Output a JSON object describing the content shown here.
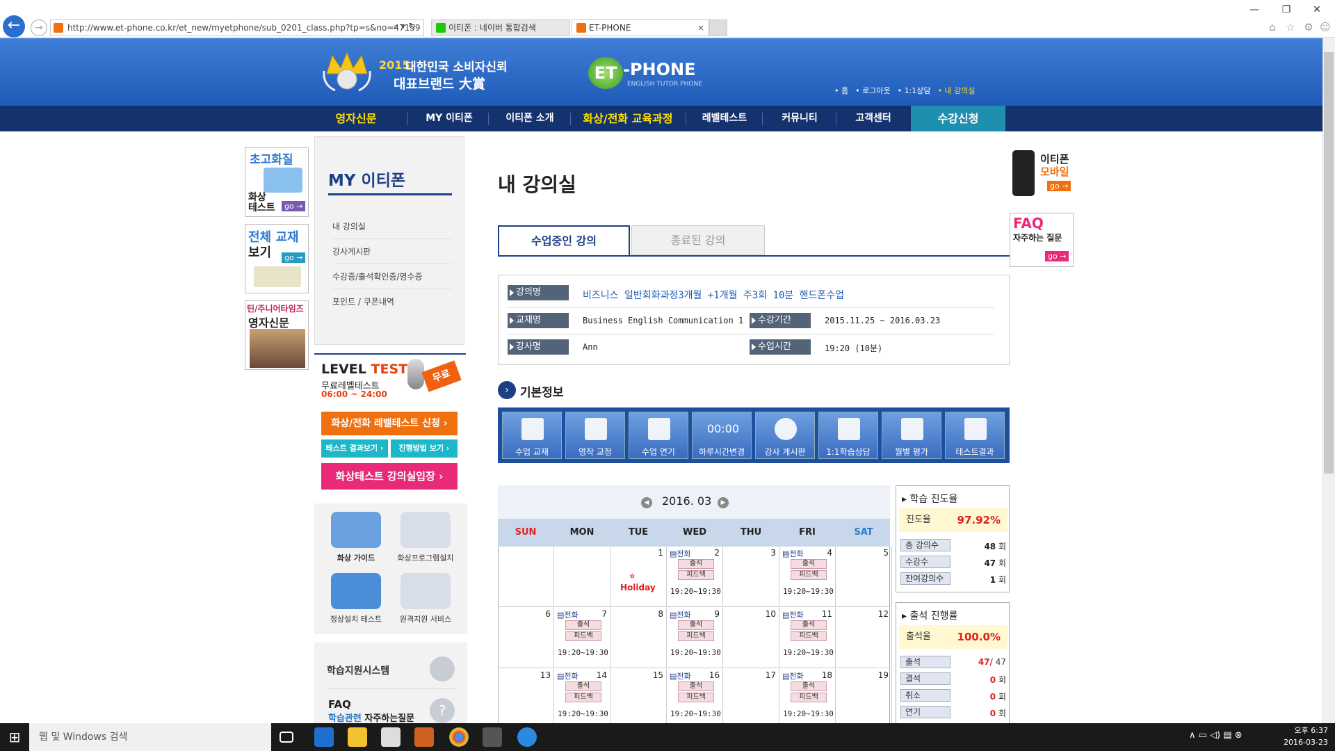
{
  "browser": {
    "url": "http://www.et-phone.co.kr/et_new/myetphone/sub_0201_class.php?tp=s&no=47159",
    "tab1": "이티폰 : 네이버 통합검색",
    "tab2": "ET-PHONE"
  },
  "header": {
    "award_year": "2015",
    "award_line1": "대한민국 소비자신뢰",
    "award_line2": "대표브랜드 大賞",
    "logo_et": "ET",
    "logo_phone": "-PHONE",
    "logo_sub": "ENGLISH TUTOR PHONE",
    "toplinks": [
      "• 홈",
      "• 로그아웃",
      "• 1:1상담",
      "• 내 강의실"
    ]
  },
  "nav": [
    "영자신문",
    "MY 이티폰",
    "이티폰 소개",
    "화상/전화 교육과정",
    "레벨테스트",
    "커뮤니티",
    "고객센터",
    "수강신청"
  ],
  "left_banners": {
    "b1_top": "초고화질",
    "b1_bottom": "화상\n테스트",
    "b2_top": "전체 교재",
    "b2_bottom": "보기",
    "b3_top": "틴/주니어타임즈",
    "b3_bottom": "영자신문",
    "go": "go →"
  },
  "mymenu": {
    "title": "MY 이티폰",
    "items": [
      "내 강의실",
      "강사게시판",
      "수강증/출석확인증/영수증",
      "포인트 / 쿠폰내역"
    ]
  },
  "leveltest": {
    "title_a": "LEVEL ",
    "title_b": "TEST",
    "free_badge": "무료",
    "sub": "무료레벨테스트",
    "hours": "06:00 ~ 24:00",
    "btn_apply": "화상/전화 레벨테스트 신청 ›",
    "btn_result": "테스트 결과보기 ›",
    "btn_method": "진행방법 보기 ›",
    "btn_enter": "화상테스트 강의실입장 ›"
  },
  "tools": [
    {
      "label": "화상 가이드"
    },
    {
      "label": "화상프로그램설치"
    },
    {
      "label": "정상설치 테스트"
    },
    {
      "label": "원격지원 서비스"
    }
  ],
  "support": {
    "label": "학습지원시스템",
    "faq_title": "FAQ",
    "faq_sub_a": "학습관련",
    "faq_sub_b": " 자주하는질문"
  },
  "main": {
    "title": "내 강의실",
    "tab_active": "수업중인 강의",
    "tab_inactive": "종료된 강의",
    "section": "기본정보"
  },
  "course": {
    "name_label": "강의명",
    "name": "비즈니스 일반회화과정3개월 +1개월 주3회 10분 핸드폰수업",
    "book_label": "교재명",
    "book": "Business English Communication 1",
    "period_label": "수강기간",
    "period": "2015.11.25 ~ 2016.03.23",
    "teacher_label": "강사명",
    "teacher": "Ann",
    "time_label": "수업시간",
    "time": "19:20 (10분)"
  },
  "iconbar": [
    "수업 교재",
    "영작 교정",
    "수업 연기",
    "하루시간변경",
    "강사 게시판",
    "1:1학습상담",
    "월별 평가",
    "테스트결과"
  ],
  "iconbar_clock": "00:00",
  "calendar": {
    "month": "2016. 03",
    "days": [
      "SUN",
      "MON",
      "TUE",
      "WED",
      "THU",
      "FRI",
      "SAT"
    ],
    "tag": "전화",
    "att": "출석",
    "fb": "피드백",
    "time": "19:20~19:30",
    "holiday": "Holiday",
    "cells": [
      {
        "d": "",
        "c": 0
      },
      {
        "d": "",
        "c": 0
      },
      {
        "d": "1",
        "c": 2
      },
      {
        "d": "2",
        "c": 1
      },
      {
        "d": "3",
        "c": 0
      },
      {
        "d": "4",
        "c": 1
      },
      {
        "d": "5",
        "c": 0
      },
      {
        "d": "6",
        "c": 0
      },
      {
        "d": "7",
        "c": 1
      },
      {
        "d": "8",
        "c": 0
      },
      {
        "d": "9",
        "c": 1
      },
      {
        "d": "10",
        "c": 0
      },
      {
        "d": "11",
        "c": 1
      },
      {
        "d": "12",
        "c": 0
      },
      {
        "d": "13",
        "c": 0
      },
      {
        "d": "14",
        "c": 1
      },
      {
        "d": "15",
        "c": 0
      },
      {
        "d": "16",
        "c": 1
      },
      {
        "d": "17",
        "c": 0
      },
      {
        "d": "18",
        "c": 1
      },
      {
        "d": "19",
        "c": 0
      }
    ]
  },
  "progress1": {
    "title": "학습 진도율",
    "rate_label": "진도율",
    "rate": "97.92%",
    "rows": [
      {
        "label": "총 강의수",
        "value": "48",
        "unit": " 회"
      },
      {
        "label": "수강수",
        "value": "47",
        "unit": " 회"
      },
      {
        "label": "잔여강의수",
        "value": "1",
        "unit": " 회"
      }
    ]
  },
  "progress2": {
    "title": "출석 진행률",
    "rate_label": "출석율",
    "rate": "100.0%",
    "rows": [
      {
        "label": "출석",
        "value": "47/",
        "unit": " 47"
      },
      {
        "label": "결석",
        "value": "0",
        "unit": " 회"
      },
      {
        "label": "취소",
        "value": "0",
        "unit": " 회"
      },
      {
        "label": "연기",
        "value": "0",
        "unit": " 회"
      }
    ]
  },
  "right_banners": {
    "mobile_a": "이티폰",
    "mobile_b": "모바일",
    "faq_a": "FAQ",
    "faq_b": "자주하는 질문",
    "go": "go →"
  },
  "taskbar": {
    "search": "웹 및 Windows 검색",
    "time": "오후 6:37",
    "date": "2016-03-23"
  }
}
